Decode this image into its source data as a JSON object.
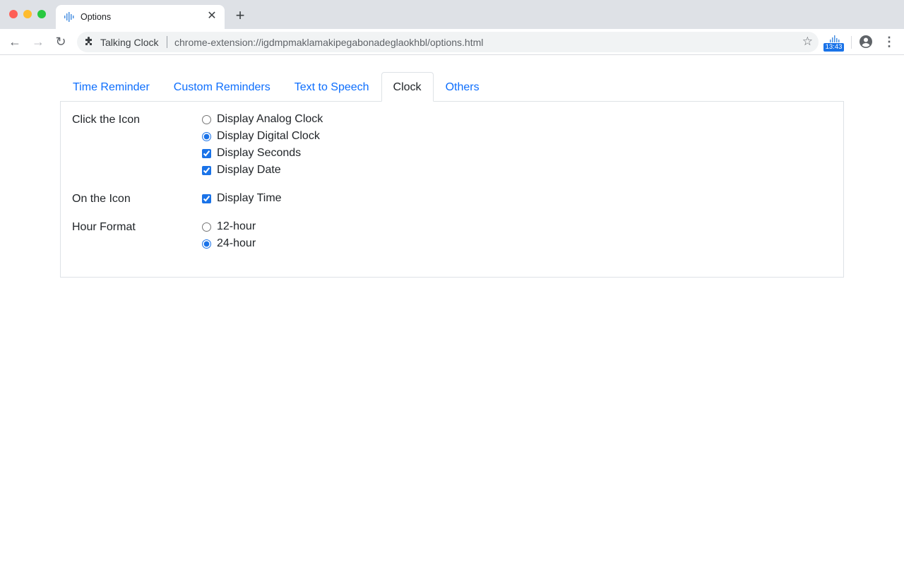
{
  "browser": {
    "tab_title": "Options",
    "tab_icon": "audio-bars-icon",
    "site_name": "Talking Clock",
    "url": "chrome-extension://igdmpmaklamakipegabonadeglaokhbl/options.html",
    "extension_badge": "13:43",
    "accent_color": "#1a73e8"
  },
  "tabs": [
    {
      "label": "Time Reminder",
      "active": false
    },
    {
      "label": "Custom Reminders",
      "active": false
    },
    {
      "label": "Text to Speech",
      "active": false
    },
    {
      "label": "Clock",
      "active": true
    },
    {
      "label": "Others",
      "active": false
    }
  ],
  "sections": {
    "click_icon": {
      "label": "Click the Icon",
      "options": [
        {
          "label": "Display Analog Clock",
          "type": "radio",
          "checked": false
        },
        {
          "label": "Display Digital Clock",
          "type": "radio",
          "checked": true
        },
        {
          "label": "Display Seconds",
          "type": "checkbox",
          "checked": true
        },
        {
          "label": "Display Date",
          "type": "checkbox",
          "checked": true
        }
      ]
    },
    "on_icon": {
      "label": "On the Icon",
      "options": [
        {
          "label": "Display Time",
          "type": "checkbox",
          "checked": true
        }
      ]
    },
    "hour_format": {
      "label": "Hour Format",
      "options": [
        {
          "label": "12-hour",
          "type": "radio",
          "checked": false
        },
        {
          "label": "24-hour",
          "type": "radio",
          "checked": true
        }
      ]
    }
  }
}
